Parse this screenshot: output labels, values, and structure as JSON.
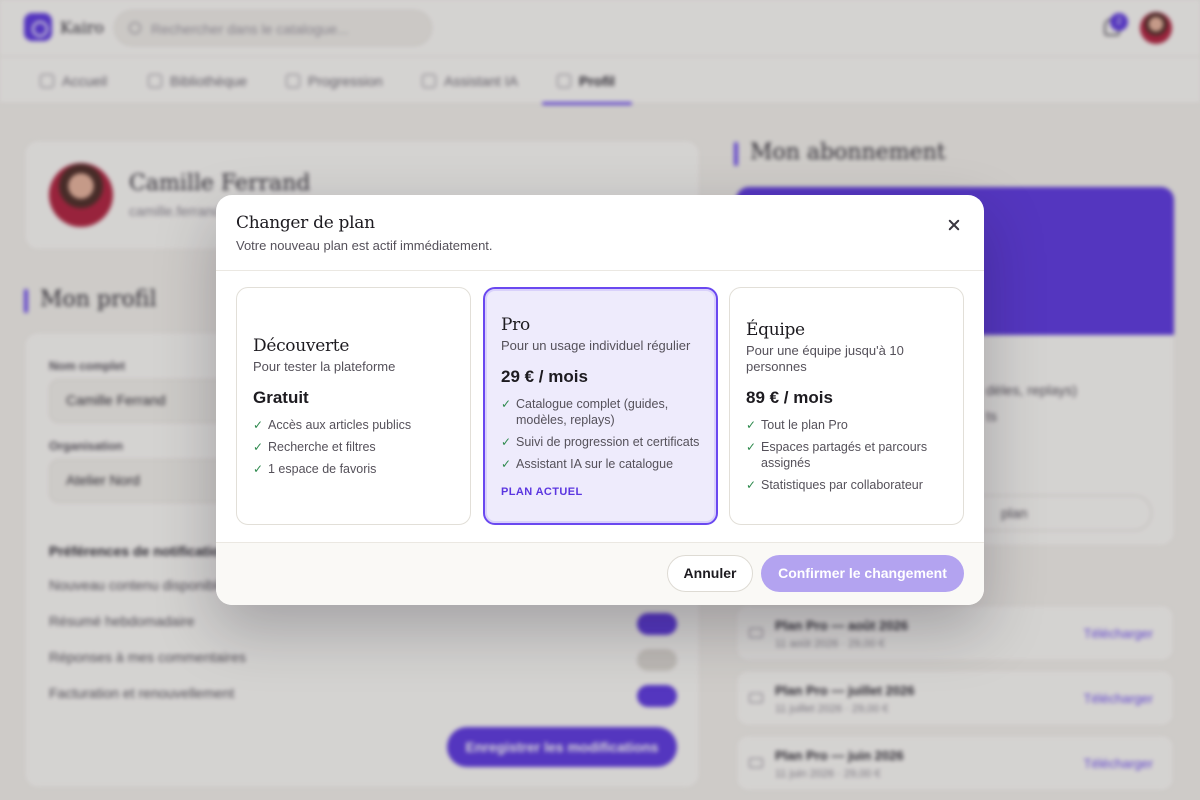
{
  "app": {
    "name": "Kairo",
    "search_placeholder": "Rechercher dans le catalogue...",
    "notification_count": "2"
  },
  "nav": {
    "items": [
      {
        "label": "Accueil",
        "icon": "home-icon"
      },
      {
        "label": "Bibliothèque",
        "icon": "library-icon"
      },
      {
        "label": "Progression",
        "icon": "trend-icon"
      },
      {
        "label": "Assistant IA",
        "icon": "robot-icon"
      },
      {
        "label": "Profil",
        "icon": "user-icon"
      }
    ],
    "active": "Profil"
  },
  "profile": {
    "name": "Camille Ferrand",
    "email": "camille.ferrand@"
  },
  "profile_form": {
    "section_title": "Mon profil",
    "full_name_label": "Nom complet",
    "full_name_value": "Camille Ferrand",
    "org_label": "Organisation",
    "org_value": "Atelier Nord",
    "prefs_title": "Préférences de notifications",
    "prefs": [
      {
        "label": "Nouveau contenu disponible",
        "on": true
      },
      {
        "label": "Résumé hebdomadaire",
        "on": true
      },
      {
        "label": "Réponses à mes commentaires",
        "on": false
      },
      {
        "label": "Facturation et renouvellement",
        "on": true
      }
    ],
    "save_label": "Enregistrer les modifications"
  },
  "subscription": {
    "section_title": "Mon abonnement",
    "line1": "dèles, replays)",
    "line2": "ts",
    "button_label": "plan"
  },
  "invoices": [
    {
      "title": "Plan Pro — août 2026",
      "meta": "11 août 2026 · 29,00 €",
      "action": "Télécharger"
    },
    {
      "title": "Plan Pro — juillet 2026",
      "meta": "11 juillet 2026 · 29,00 €",
      "action": "Télécharger"
    },
    {
      "title": "Plan Pro — juin 2026",
      "meta": "11 juin 2026 · 29,00 €",
      "action": "Télécharger"
    }
  ],
  "modal": {
    "title": "Changer de plan",
    "subtitle": "Votre nouveau plan est actif immédiatement.",
    "plans": [
      {
        "name": "Découverte",
        "description": "Pour tester la plateforme",
        "price": "Gratuit",
        "features": [
          "Accès aux articles publics",
          "Recherche et filtres",
          "1 espace de favoris"
        ],
        "badge": "",
        "current": false
      },
      {
        "name": "Pro",
        "description": "Pour un usage individuel régulier",
        "price": "29 € / mois",
        "features": [
          "Catalogue complet (guides, modèles, replays)",
          "Suivi de progression et certificats",
          "Assistant IA sur le catalogue"
        ],
        "badge": "PLAN ACTUEL",
        "current": true
      },
      {
        "name": "Équipe",
        "description": "Pour une équipe jusqu'à 10 personnes",
        "price": "89 € / mois",
        "features": [
          "Tout le plan Pro",
          "Espaces partagés et parcours assignés",
          "Statistiques par collaborateur"
        ],
        "badge": "",
        "current": false
      }
    ],
    "cancel_label": "Annuler",
    "confirm_label": "Confirmer le changement",
    "check_glyph": "✓"
  },
  "colors": {
    "accent": "#5b36e0",
    "confirm_disabled": "#b3a3f0",
    "check": "#2f8a4e"
  }
}
